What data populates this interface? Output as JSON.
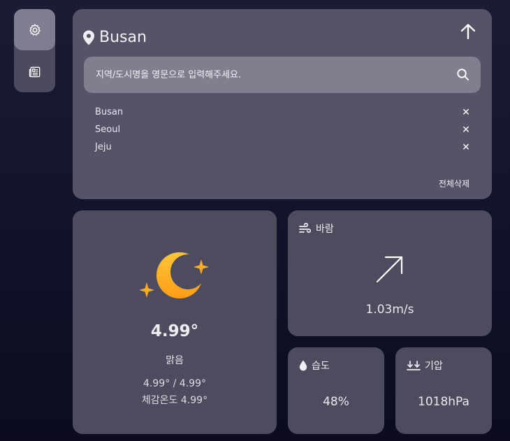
{
  "sidebar": {
    "items": [
      {
        "icon": "gear-icon",
        "active": true
      },
      {
        "icon": "newspaper-icon",
        "active": false
      }
    ]
  },
  "location": {
    "name": "Busan"
  },
  "search": {
    "placeholder": "지역/도시명을 영문으로 입력해주세요.",
    "value": ""
  },
  "history": {
    "items": [
      "Busan",
      "Seoul",
      "Jeju"
    ],
    "delete_symbol": "✕",
    "clear_all_label": "전체삭제"
  },
  "weather": {
    "icon": "moon-stars-icon",
    "temperature": "4.99°",
    "description": "맑음",
    "range": "4.99° / 4.99°",
    "feels_like": "체감온도 4.99°"
  },
  "wind": {
    "label": "바람",
    "value": "1.03m/s",
    "direction_icon": "arrow-up-right-icon"
  },
  "humidity": {
    "label": "습도",
    "value": "48%"
  },
  "pressure": {
    "label": "기압",
    "value": "1018hPa"
  },
  "colors": {
    "background": "#15142c",
    "card": "#4d4c5e",
    "search_box": "#807f90",
    "moon_accent": "#ffa41c"
  }
}
